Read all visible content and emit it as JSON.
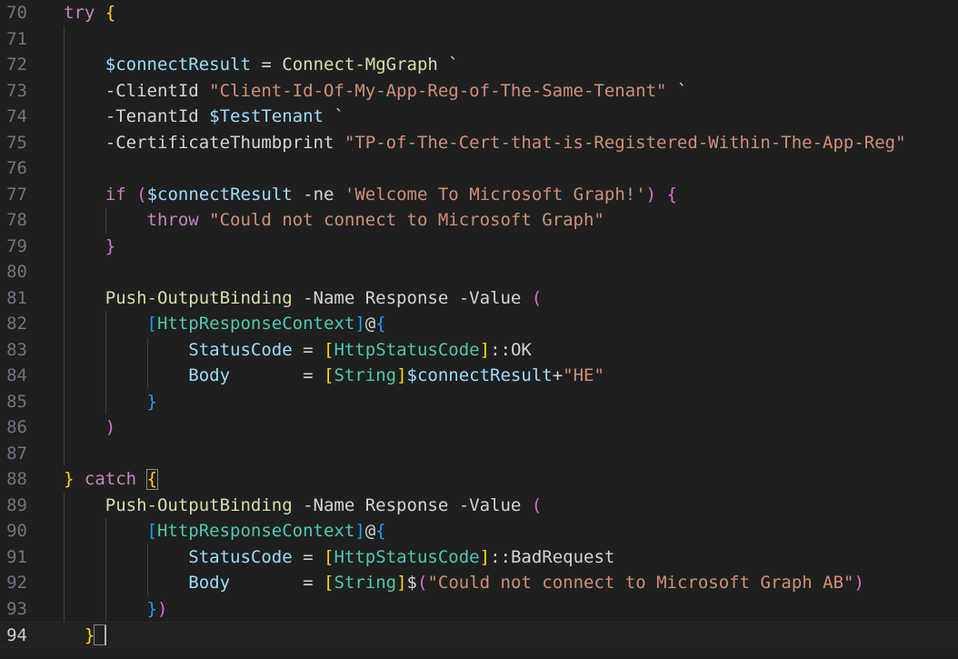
{
  "editor": {
    "lines": [
      {
        "num": "70",
        "tokens": [
          [
            "kw",
            "try"
          ],
          [
            "plain",
            " "
          ],
          [
            "b1",
            "{"
          ]
        ]
      },
      {
        "num": "71",
        "tokens": []
      },
      {
        "num": "72",
        "tokens": [
          [
            "plain",
            "    "
          ],
          [
            "var",
            "$connectResult"
          ],
          [
            "plain",
            " = "
          ],
          [
            "cmd",
            "Connect-MgGraph"
          ],
          [
            "plain",
            " `"
          ]
        ]
      },
      {
        "num": "73",
        "tokens": [
          [
            "plain",
            "    -ClientId "
          ],
          [
            "str",
            "\"Client-Id-Of-My-App-Reg-of-The-Same-Tenant\""
          ],
          [
            "plain",
            " `"
          ]
        ]
      },
      {
        "num": "74",
        "tokens": [
          [
            "plain",
            "    -TenantId "
          ],
          [
            "var",
            "$TestTenant"
          ],
          [
            "plain",
            " `"
          ]
        ]
      },
      {
        "num": "75",
        "tokens": [
          [
            "plain",
            "    -CertificateThumbprint "
          ],
          [
            "str",
            "\"TP-of-The-Cert-that-is-Registered-Within-The-App-Reg\""
          ]
        ]
      },
      {
        "num": "76",
        "tokens": []
      },
      {
        "num": "77",
        "tokens": [
          [
            "plain",
            "    "
          ],
          [
            "kw",
            "if"
          ],
          [
            "plain",
            " "
          ],
          [
            "b2",
            "("
          ],
          [
            "var",
            "$connectResult"
          ],
          [
            "plain",
            " -ne "
          ],
          [
            "str",
            "'Welcome To Microsoft Graph!'"
          ],
          [
            "b2",
            ")"
          ],
          [
            "plain",
            " "
          ],
          [
            "b2",
            "{"
          ]
        ]
      },
      {
        "num": "78",
        "tokens": [
          [
            "plain",
            "        "
          ],
          [
            "kw",
            "throw"
          ],
          [
            "plain",
            " "
          ],
          [
            "str",
            "\"Could not connect to Microsoft Graph\""
          ]
        ]
      },
      {
        "num": "79",
        "tokens": [
          [
            "plain",
            "    "
          ],
          [
            "b2",
            "}"
          ]
        ]
      },
      {
        "num": "80",
        "tokens": []
      },
      {
        "num": "81",
        "tokens": [
          [
            "plain",
            "    "
          ],
          [
            "cmd",
            "Push-OutputBinding"
          ],
          [
            "plain",
            " -Name Response -Value "
          ],
          [
            "b2",
            "("
          ]
        ]
      },
      {
        "num": "82",
        "tokens": [
          [
            "plain",
            "        "
          ],
          [
            "b3",
            "["
          ],
          [
            "type",
            "HttpResponseContext"
          ],
          [
            "b3",
            "]"
          ],
          [
            "plain",
            "@"
          ],
          [
            "b3",
            "{"
          ]
        ]
      },
      {
        "num": "83",
        "tokens": [
          [
            "plain",
            "            "
          ],
          [
            "prop",
            "StatusCode"
          ],
          [
            "plain",
            " = "
          ],
          [
            "b1",
            "["
          ],
          [
            "type",
            "HttpStatusCode"
          ],
          [
            "b1",
            "]"
          ],
          [
            "plain",
            "::OK"
          ]
        ]
      },
      {
        "num": "84",
        "tokens": [
          [
            "plain",
            "            "
          ],
          [
            "prop",
            "Body"
          ],
          [
            "plain",
            "       = "
          ],
          [
            "b1",
            "["
          ],
          [
            "type",
            "String"
          ],
          [
            "b1",
            "]"
          ],
          [
            "var",
            "$connectResult"
          ],
          [
            "plain",
            "+"
          ],
          [
            "str",
            "\"HE\""
          ]
        ]
      },
      {
        "num": "85",
        "tokens": [
          [
            "plain",
            "        "
          ],
          [
            "b3",
            "}"
          ]
        ]
      },
      {
        "num": "86",
        "tokens": [
          [
            "plain",
            "    "
          ],
          [
            "b2",
            ")"
          ]
        ]
      },
      {
        "num": "87",
        "tokens": []
      },
      {
        "num": "88",
        "tokens": [
          [
            "b1",
            "}"
          ],
          [
            "plain",
            " "
          ],
          [
            "kw",
            "catch"
          ],
          [
            "plain",
            " "
          ],
          [
            "b1",
            "{"
          ]
        ]
      },
      {
        "num": "89",
        "tokens": [
          [
            "plain",
            "    "
          ],
          [
            "cmd",
            "Push-OutputBinding"
          ],
          [
            "plain",
            " -Name Response -Value "
          ],
          [
            "b2",
            "("
          ]
        ]
      },
      {
        "num": "90",
        "tokens": [
          [
            "plain",
            "        "
          ],
          [
            "b3",
            "["
          ],
          [
            "type",
            "HttpResponseContext"
          ],
          [
            "b3",
            "]"
          ],
          [
            "plain",
            "@"
          ],
          [
            "b3",
            "{"
          ]
        ]
      },
      {
        "num": "91",
        "tokens": [
          [
            "plain",
            "            "
          ],
          [
            "prop",
            "StatusCode"
          ],
          [
            "plain",
            " = "
          ],
          [
            "b1",
            "["
          ],
          [
            "type",
            "HttpStatusCode"
          ],
          [
            "b1",
            "]"
          ],
          [
            "plain",
            "::BadRequest"
          ]
        ]
      },
      {
        "num": "92",
        "tokens": [
          [
            "plain",
            "            "
          ],
          [
            "prop",
            "Body"
          ],
          [
            "plain",
            "       = "
          ],
          [
            "b1",
            "["
          ],
          [
            "type",
            "String"
          ],
          [
            "b1",
            "]"
          ],
          [
            "plain",
            "$"
          ],
          [
            "b2",
            "("
          ],
          [
            "str",
            "\"Could not connect to Microsoft Graph AB\""
          ],
          [
            "b2",
            ")"
          ]
        ]
      },
      {
        "num": "93",
        "tokens": [
          [
            "plain",
            "        "
          ],
          [
            "b3",
            "}"
          ],
          [
            "b2",
            ")"
          ]
        ]
      },
      {
        "num": "94",
        "tokens": [
          [
            "plain",
            "  "
          ],
          [
            "b1",
            "}"
          ]
        ]
      }
    ],
    "current_line": "94"
  }
}
